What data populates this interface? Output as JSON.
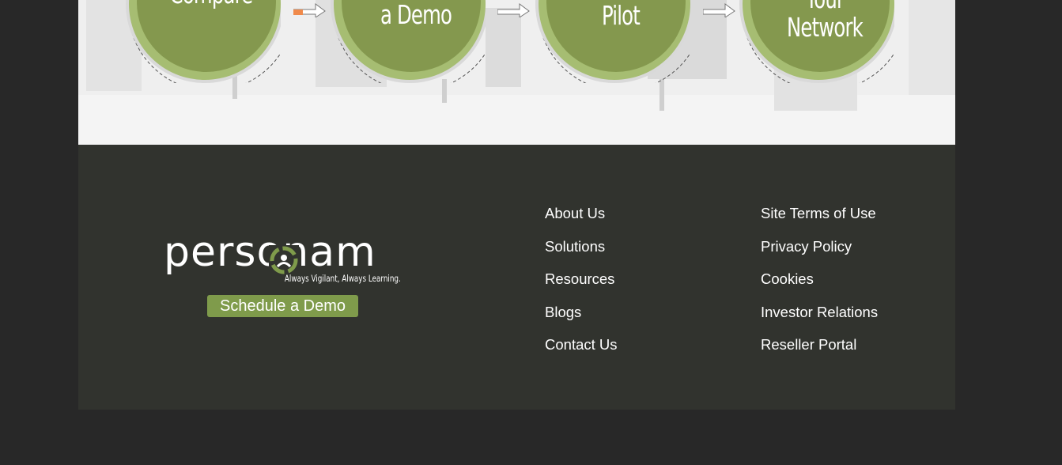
{
  "steps": [
    {
      "label": "Compare"
    },
    {
      "label": "a Demo"
    },
    {
      "label": "Pilot"
    },
    {
      "label": "Your\nNetwork"
    }
  ],
  "brand": {
    "name": "personam",
    "tagline": "Always Vigilant, Always Learning.",
    "cta_label": "Schedule a Demo"
  },
  "footer": {
    "col1": [
      "About Us",
      "Solutions",
      "Resources",
      "Blogs",
      "Contact Us"
    ],
    "col2": [
      "Site Terms of Use",
      "Privacy Policy",
      "Cookies",
      "Investor Relations",
      "Reseller Portal"
    ]
  },
  "colors": {
    "page_bg": "#282828",
    "footer_bg": "#31332e",
    "accent_green": "#7f9b4b",
    "circle_green": "#84984e"
  }
}
